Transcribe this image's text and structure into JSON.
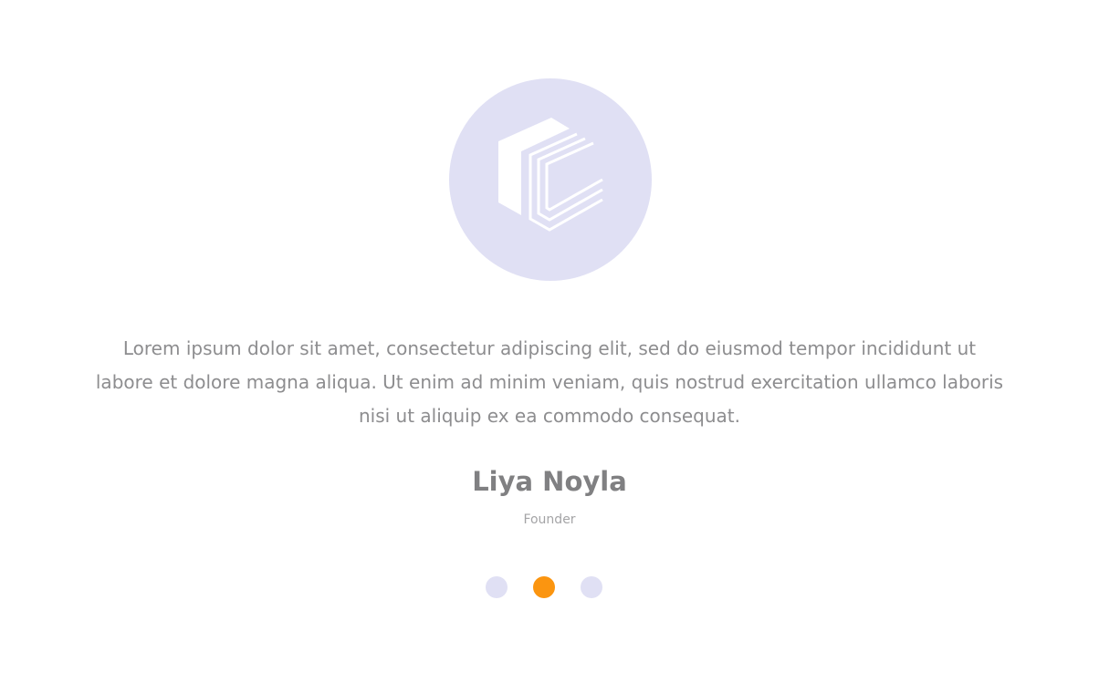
{
  "testimonial": {
    "avatar_icon": "company-logo-cube-icon",
    "quote": "Lorem ipsum dolor sit amet, consectetur adipiscing elit, sed do eiusmod tempor incididunt ut labore et dolore magna aliqua. Ut enim ad minim veniam, quis nostrud exercitation ullamco laboris nisi ut aliquip ex ea commodo consequat.",
    "name": "Liya Noyla",
    "role": "Founder"
  },
  "pagination": {
    "total": 3,
    "active_index": 1
  },
  "colors": {
    "avatar_background": "#e0e0f4",
    "dot_inactive": "#e0e0f4",
    "dot_active": "#fb9510",
    "text": "#8d8d8f"
  }
}
